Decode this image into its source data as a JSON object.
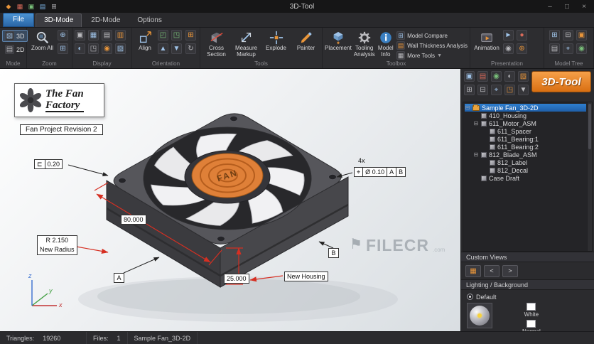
{
  "titlebar": {
    "title": "3D-Tool"
  },
  "window_controls": {
    "minimize": "–",
    "maximize": "□",
    "close": "×"
  },
  "tabs": {
    "file": "File",
    "items": [
      "3D-Mode",
      "2D-Mode",
      "Options"
    ]
  },
  "ribbon": {
    "mode": {
      "label": "Mode",
      "btn3d": "3D",
      "btn2d": "2D"
    },
    "zoom": {
      "label": "Zoom",
      "zoom_all": "Zoom All"
    },
    "display": {
      "label": "Display"
    },
    "orientation": {
      "label": "Orientation",
      "align": "Align"
    },
    "tools": {
      "label": "Tools",
      "cross_section": "Cross Section",
      "measure_markup": "Measure Markup",
      "explode": "Explode",
      "painter": "Painter"
    },
    "toolbox": {
      "label": "Toolbox",
      "placement": "Placement",
      "tooling_analysis": "Tooling Analysis",
      "model_info": "Model Info",
      "model_compare": "Model Compare",
      "wall_thickness": "Wall Thickness Analysis",
      "more_tools": "More Tools"
    },
    "presentation": {
      "label": "Presentation",
      "animation": "Animation"
    },
    "model_tree": {
      "label": "Model Tree"
    }
  },
  "viewport": {
    "logo": {
      "line1": "The Fan",
      "line2": "Factory"
    },
    "revision_label": "Fan Project Revision 2",
    "fan_text": "FAN",
    "annotations": {
      "surface_profile_symbol": "⊏",
      "surface_profile_value": "0.20",
      "radius_value": "R 2.150",
      "radius_note": "New Radius",
      "dim_width": "80.000",
      "dim_depth": "25.000",
      "housing_note": "New Housing",
      "hole_count": "4x",
      "position_symbol": "⌖",
      "position_tolerance": "Ø 0.10",
      "datum_ref_1": "A",
      "datum_ref_2": "B",
      "datum_a": "A",
      "datum_b": "B"
    },
    "axes": {
      "x": "x",
      "y": "y",
      "z": "z"
    },
    "watermark": {
      "text": "FILECR",
      "suffix": ".com"
    }
  },
  "sidebar": {
    "logo": "3D-Tool",
    "tree": {
      "root": "Sample Fan_3D-2D",
      "items": [
        {
          "label": "410_Housing",
          "level": 1
        },
        {
          "label": "611_Motor_ASM",
          "level": 1,
          "expanded": true
        },
        {
          "label": "611_Spacer",
          "level": 2
        },
        {
          "label": "611_Bearing:1",
          "level": 2
        },
        {
          "label": "611_Bearing:2",
          "level": 2
        },
        {
          "label": "812_Blade_ASM",
          "level": 1,
          "expanded": true
        },
        {
          "label": "812_Label",
          "level": 2
        },
        {
          "label": "812_Decal",
          "level": 2
        },
        {
          "label": "Case Draft",
          "level": 1
        }
      ]
    },
    "custom_views": {
      "title": "Custom Views",
      "prev": "<",
      "next": ">"
    },
    "lighting": {
      "title": "Lighting / Background",
      "default_option": "Default",
      "white_label": "White",
      "normal_label": "Normal"
    }
  },
  "statusbar": {
    "triangles_label": "Triangles:",
    "triangles_value": "19260",
    "files_label": "Files:",
    "files_value": "1",
    "model_name": "Sample Fan_3D-2D"
  },
  "colors": {
    "accent_orange": "#e8832e",
    "selection_blue": "#2e74c0",
    "dimension_red": "#d62f22",
    "hub_orange": "#df8038"
  }
}
